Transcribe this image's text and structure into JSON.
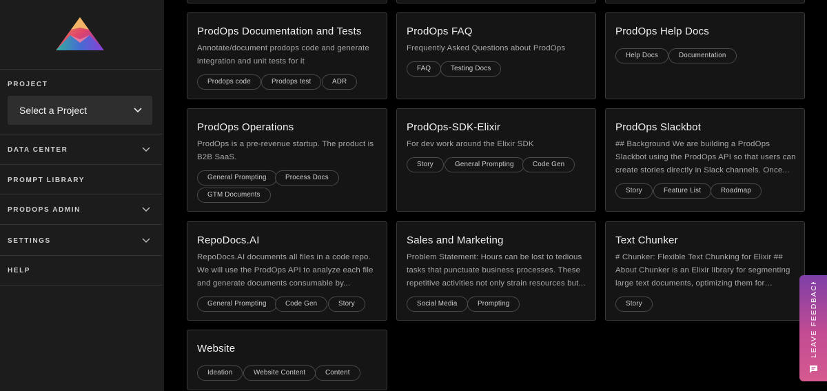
{
  "sidebar": {
    "sections": {
      "project": "PROJECT",
      "data_center": "DATA CENTER",
      "prompt_library": "PROMPT LIBRARY",
      "prodops_admin": "PRODOPS ADMIN",
      "settings": "SETTINGS",
      "help": "HELP"
    },
    "project_select": {
      "value": "Select a Project"
    }
  },
  "cards": {
    "documentation_tests": {
      "title": "ProdOps Documentation and Tests",
      "description": "Annotate/document prodops code and generate integration and unit tests for it",
      "tags": [
        "Prodops code",
        "Prodops test",
        "ADR"
      ]
    },
    "faq": {
      "title": "ProdOps FAQ",
      "description": "Frequently Asked Questions about ProdOps",
      "tags": [
        "FAQ",
        "Testing Docs"
      ]
    },
    "help_docs": {
      "title": "ProdOps Help Docs",
      "description": "",
      "tags": [
        "Help Docs",
        "Documentation"
      ]
    },
    "operations": {
      "title": "ProdOps Operations",
      "description": "ProdOps is a pre-revenue startup. The product is B2B SaaS.",
      "tags": [
        "General Prompting",
        "Process Docs",
        "GTM Documents"
      ]
    },
    "sdk_elixir": {
      "title": "ProdOps-SDK-Elixir",
      "description": "For dev work around the Elixir SDK",
      "tags": [
        "Story",
        "General Prompting",
        "Code Gen"
      ]
    },
    "slackbot": {
      "title": "ProdOps Slackbot",
      "description": "## Background We are building a ProdOps Slackbot using the ProdOps API so that users can create stories directly in Slack channels. Once...",
      "tags": [
        "Story",
        "Feature List",
        "Roadmap"
      ]
    },
    "repodocs": {
      "title": "RepoDocs.AI",
      "description": "RepoDocs.AI documents all files in a code repo. We will use the ProdOps API to analyze each file and generate documents consumable by...",
      "tags": [
        "General Prompting",
        "Code Gen",
        "Story"
      ]
    },
    "sales_marketing": {
      "title": "Sales and Marketing",
      "description": "Problem Statement: Hours can be lost to tedious tasks that punctuate business processes. These repetitive activities not only strain resources but...",
      "tags": [
        "Social Media",
        "Prompting"
      ]
    },
    "text_chunker": {
      "title": "Text Chunker",
      "description": "# Chunker: Flexible Text Chunking for Elixir ## About Chunker is an Elixir library for segmenting large text documents, optimizing them for efficien...",
      "tags": [
        "Story"
      ]
    },
    "website": {
      "title": "Website",
      "description": "",
      "tags": [
        "Ideation",
        "Website Content",
        "Content"
      ]
    }
  },
  "feedback": {
    "label": "LEAVE FEEDBACK"
  },
  "colors": {
    "sidebar_bg": "#1c1c1c",
    "card_bg": "#151515",
    "card_border": "#3a3a3a",
    "feedback_gradient_top": "#7e3fa6",
    "feedback_gradient_bottom": "#d55a90"
  },
  "icons": {
    "logo": "prodops-mountain-logo",
    "chevron": "chevron-down-icon",
    "feedback": "chat-bubble-icon"
  }
}
